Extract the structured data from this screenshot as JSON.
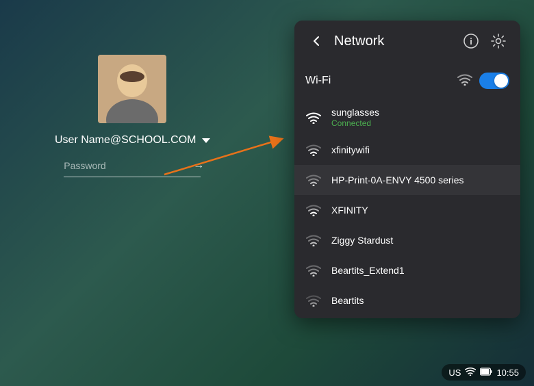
{
  "background": {
    "color_start": "#1a3a4a",
    "color_end": "#152e38"
  },
  "login": {
    "username": "User Name@SCHOOL.COM",
    "password_placeholder": "Password"
  },
  "panel": {
    "title": "Network",
    "back_label": "←",
    "wifi_label": "Wi-Fi",
    "networks": [
      {
        "name": "sunglasses",
        "status": "Connected",
        "signal": 4,
        "connected": true
      },
      {
        "name": "xfinitywifi",
        "status": "",
        "signal": 3,
        "connected": false
      },
      {
        "name": "HP-Print-0A-ENVY 4500 series",
        "status": "",
        "signal": 2,
        "connected": false
      },
      {
        "name": "XFINITY",
        "status": "",
        "signal": 3,
        "connected": false
      },
      {
        "name": "Ziggy Stardust",
        "status": "",
        "signal": 2,
        "connected": false
      },
      {
        "name": "Beartits_Extend1",
        "status": "",
        "signal": 2,
        "connected": false
      },
      {
        "name": "Beartits",
        "status": "",
        "signal": 1,
        "connected": false
      }
    ]
  },
  "taskbar": {
    "locale": "US",
    "time": "10:55"
  }
}
